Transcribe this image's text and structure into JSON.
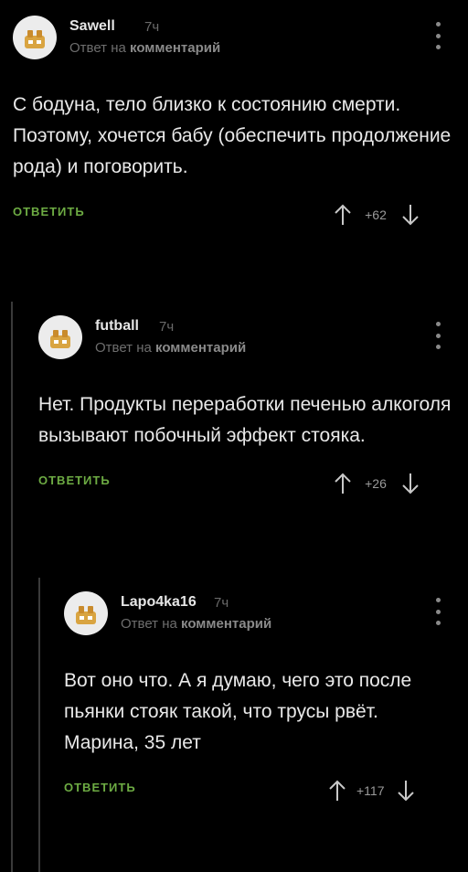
{
  "comments": [
    {
      "author": "Sawell",
      "time": "7ч",
      "reply_prefix": "Ответ на",
      "reply_target": "комментарий",
      "text": "С бодуна, тело близко к состоянию смерти. Поэтому, хочется бабу (обеспечить продолжение рода) и поговорить.",
      "reply_label": "ОТВЕТИТЬ",
      "rating": "+62"
    },
    {
      "author": "futball",
      "time": "7ч",
      "reply_prefix": "Ответ на",
      "reply_target": "комментарий",
      "text": "Нет. Продукты переработки печенью алкоголя вызывают побочный эффект стояка.",
      "reply_label": "ОТВЕТИТЬ",
      "rating": "+26"
    },
    {
      "author": "Lapo4ka16",
      "time": "7ч",
      "reply_prefix": "Ответ на",
      "reply_target": "комментарий",
      "text": "Вот оно что. А я думаю, чего это после пьянки стояк такой, что трусы рвёт. Марина, 35 лет",
      "reply_label": "ОТВЕТИТЬ",
      "rating": "+117"
    }
  ],
  "colors": {
    "background": "#000000",
    "accent_green": "#6dab43",
    "text": "#e9e9e9",
    "muted": "#6e6e6e"
  },
  "icons": {
    "avatar": "default-avatar-icon",
    "more": "more-vertical-icon",
    "upvote": "arrow-up-icon",
    "downvote": "arrow-down-icon"
  }
}
